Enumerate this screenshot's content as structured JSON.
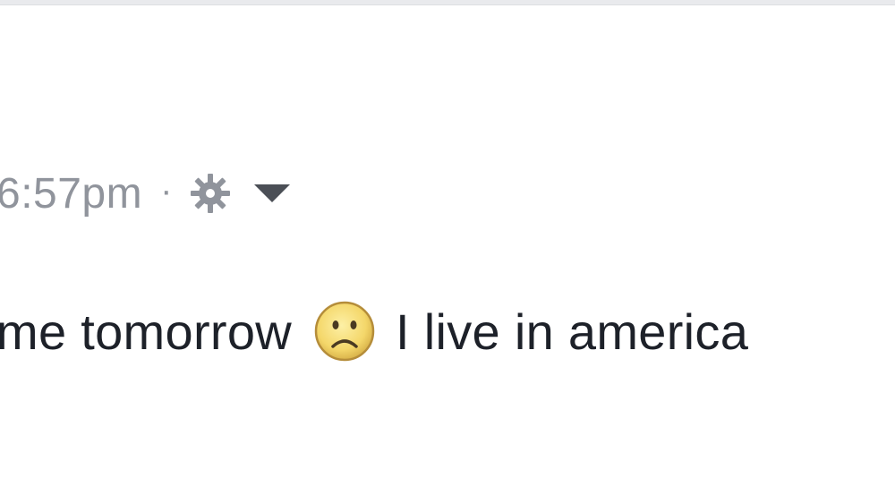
{
  "post": {
    "timestamp": "6:57pm",
    "separator": "·",
    "audience_icon": "gear-icon",
    "menu_icon": "caret-down-icon",
    "text_before_emoji": "me tomorrow",
    "emoji": "frowning-face-emoji",
    "text_after_emoji": "I live in america"
  },
  "colors": {
    "meta_text": "#90949c",
    "body_text": "#1d2129",
    "top_border": "#e9eaed"
  }
}
